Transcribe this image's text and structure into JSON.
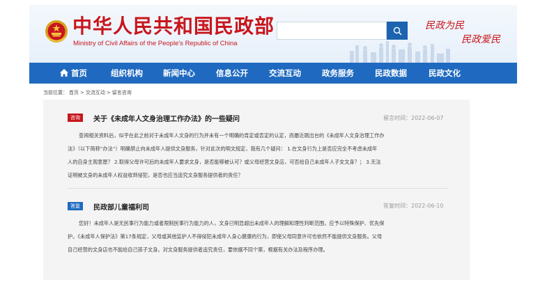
{
  "header": {
    "title": "中华人民共和国民政部",
    "subtitle": "Ministry of Civil Affairs of the People's Republic of China",
    "search_placeholder": "",
    "slogan_line1": "民政为民",
    "slogan_line2": "民政爱民"
  },
  "nav": {
    "items": [
      "首页",
      "组织机构",
      "新闻中心",
      "信息公开",
      "交流互动",
      "政务服务",
      "民政数据",
      "民政文化"
    ]
  },
  "breadcrumb": {
    "prefix": "当前位置：",
    "items": [
      "首页",
      "交流互动",
      "留言咨询"
    ],
    "separator": ">"
  },
  "question": {
    "badge": "咨询",
    "title": "关于《未成年人文身治理工作办法》的一些疑问",
    "time": "留言时间：2022-06-07",
    "body_lines": [
      "查阅相关资料后，似乎在此之前对于未成年人文身的行为并未有一个明确的肯定或否定的认定，而最近刚出台的《未成年人文身治理工作办",
      "法》（以下简称“办法”）明确禁止向未成年人提供文身服务，针对此次的明文规定，我有几个疑问： 1.在文身行为上是否应完全不考虑未成年",
      "人的自身主观意愿？ 2.取得父母许可后的未成年人要求文身，是否能够被认可？或父母经营文身店，可否给自己未成年人子女文身？； 3.无法",
      "证明被文身的未成年人权益收到侵犯，是否也应当追究文身服务提供者的责任？"
    ]
  },
  "answer": {
    "badge": "答复",
    "title": "民政部儿童福利司",
    "time": "答复时间：2022-06-10",
    "body_lines": [
      "您好！未成年人是无民事行为能力或者限制民事行为能力的人，文身已明显超出未成年人的理解和理性判断范围，应予以特殊保护、优先保",
      "护。《未成年人保护法》第17条规定，父母或其他监护人不得侵犯未成年人身心健康的行为，即使父母同意许可也依然不能提供文身服务。父母",
      "自己经营的文身店也不能给自己孩子文身。对文身服务提供者追究责任，要依据不同个案，根据有关办法及程序办理。"
    ]
  },
  "colors": {
    "brand_red": "#c8161d",
    "nav_blue": "#1f6ac0"
  }
}
